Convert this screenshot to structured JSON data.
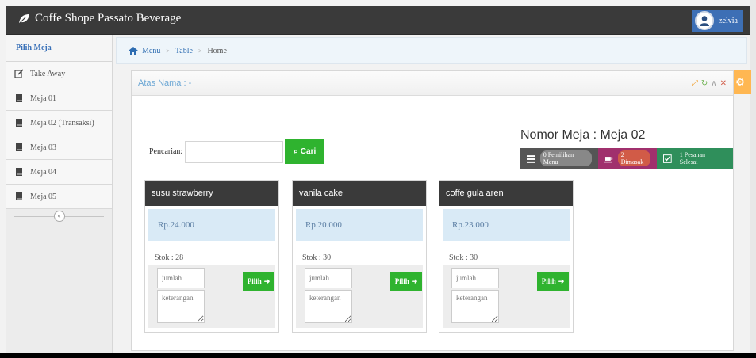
{
  "app": {
    "title": "Coffe Shope Passato Beverage",
    "user": "zelvia"
  },
  "sidebar": {
    "header": "Pilih Meja",
    "items": [
      {
        "label": "Take Away",
        "icon": "edit-icon"
      },
      {
        "label": "Meja 01",
        "icon": "book-icon"
      },
      {
        "label": "Meja 02 (Transaksi)",
        "icon": "book-icon"
      },
      {
        "label": "Meja 03",
        "icon": "book-icon"
      },
      {
        "label": "Meja 04",
        "icon": "book-icon"
      },
      {
        "label": "Meja 05",
        "icon": "book-icon"
      }
    ]
  },
  "breadcrumb": [
    "Menu",
    "Table",
    "Home"
  ],
  "panel": {
    "title": "Atas Nama : -",
    "nomor_meja": "Nomor Meja : Meja 02",
    "status": [
      {
        "label": "0 Pemilihan Menu",
        "color": "#555555"
      },
      {
        "label": "2 Dimasak",
        "color": "#a0306d"
      },
      {
        "label": "1 Pesanan Selesai",
        "color": "#2f8f5b"
      }
    ],
    "search_label": "Pencarian:",
    "search_value": "",
    "search_button": "Cari"
  },
  "products": [
    {
      "name": "susu strawberry",
      "price": "Rp.24.000",
      "stok": "Stok : 28",
      "jumlah_placeholder": "jumlah",
      "keterangan": "keterangan",
      "button": "Pilih"
    },
    {
      "name": "vanila cake",
      "price": "Rp.20.000",
      "stok": "Stok : 30",
      "jumlah_placeholder": "jumlah",
      "keterangan": "keterangan",
      "button": "Pilih"
    },
    {
      "name": "coffe gula aren",
      "price": "Rp.23.000",
      "stok": "Stok : 30",
      "jumlah_placeholder": "jumlah",
      "keterangan": "keterangan",
      "button": "Pilih"
    }
  ]
}
